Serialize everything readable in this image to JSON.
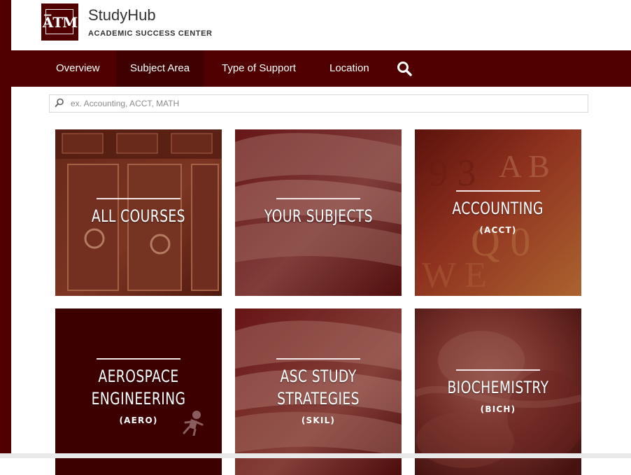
{
  "brand": {
    "logo_text": "A̅TM",
    "name": "StudyHub",
    "subtitle": "ACADEMIC SUCCESS CENTER"
  },
  "nav": {
    "items": [
      {
        "label": "Overview"
      },
      {
        "label": "Subject Area"
      },
      {
        "label": "Type of Support"
      },
      {
        "label": "Location"
      }
    ],
    "active": "Subject Area",
    "search_icon": "search-icon"
  },
  "search": {
    "placeholder": "ex. Accounting, ACCT, MATH",
    "value": ""
  },
  "tiles": [
    {
      "title": "ALL COURSES",
      "code": ""
    },
    {
      "title": "YOUR SUBJECTS",
      "code": ""
    },
    {
      "title": "ACCOUNTING",
      "code": "(ACCT)"
    },
    {
      "title": "AEROSPACE ENGINEERING",
      "code": "(AERO)"
    },
    {
      "title": "ASC STUDY STRATEGIES",
      "code": "(SKIL)"
    },
    {
      "title": "BIOCHEMISTRY",
      "code": "(BICH)"
    }
  ],
  "colors": {
    "brand_maroon": "#500000",
    "active_nav": "#3e0000"
  }
}
